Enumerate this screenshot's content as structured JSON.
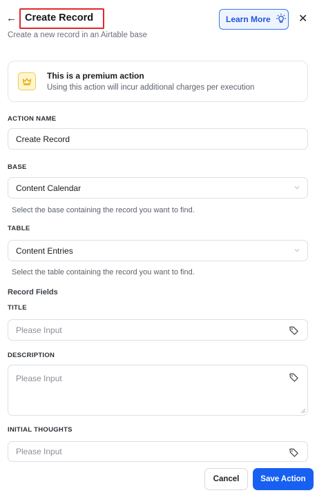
{
  "header": {
    "back_icon": "arrow-left-icon",
    "title": "Create Record",
    "subtitle": "Create a new record in an Airtable base",
    "learn_more_label": "Learn More",
    "learn_more_icon": "lightbulb-icon",
    "close_icon": "close-icon"
  },
  "premium": {
    "icon": "crown-icon",
    "title": "This is a premium action",
    "description": "Using this action will incur additional charges per execution"
  },
  "action_name": {
    "label": "ACTION NAME",
    "value": "Create Record"
  },
  "base": {
    "label": "BASE",
    "value": "Content Calendar",
    "hint": "Select the base containing the record you want to find."
  },
  "table": {
    "label": "TABLE",
    "value": "Content Entries",
    "hint": "Select the table containing the record you want to find."
  },
  "record_fields": {
    "heading": "Record Fields",
    "title_field": {
      "label": "TITLE",
      "placeholder": "Please Input"
    },
    "description_field": {
      "label": "DESCRIPTION",
      "placeholder": "Please Input"
    },
    "initial_thoughts_field": {
      "label": "INITIAL THOUGHTS",
      "placeholder": "Please Input"
    }
  },
  "footer": {
    "cancel_label": "Cancel",
    "save_label": "Save Action"
  },
  "colors": {
    "highlight_border": "#e0262b",
    "accent": "#1760f2",
    "premium_bg": "#fff5d0"
  }
}
